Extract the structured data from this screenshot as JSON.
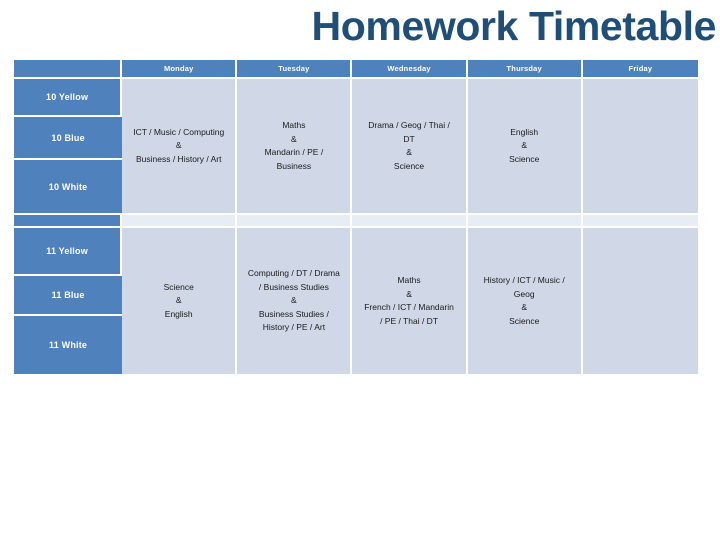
{
  "slide": {
    "title": "Homework Timetable",
    "title_color": "#1F4E79",
    "header_fill": "#4F81BD",
    "cell_fill": "#D0D8E8",
    "spacer_fill": "#E8ECF4"
  },
  "table": {
    "corner_label": "",
    "day_headers": [
      "Monday",
      "Tuesday",
      "Wednesday",
      "Thursday",
      "Friday"
    ],
    "blocks": [
      {
        "year": "10",
        "row_labels": [
          "10 Yellow",
          "10 Blue",
          "10 White"
        ],
        "cells": [
          {
            "day": "Monday",
            "lines": [
              "ICT / Music / Computing",
              "&",
              "Business / History / Art"
            ]
          },
          {
            "day": "Tuesday",
            "lines": [
              "Maths",
              "&",
              "Mandarin / PE /",
              "Business"
            ]
          },
          {
            "day": "Wednesday",
            "lines": [
              "Drama / Geog / Thai /",
              "DT",
              "&",
              "Science"
            ]
          },
          {
            "day": "Thursday",
            "lines": [
              "English",
              "&",
              "Science"
            ]
          },
          {
            "day": "Friday",
            "lines": []
          }
        ]
      },
      {
        "year": "11",
        "row_labels": [
          "11 Yellow",
          "11 Blue",
          "11 White"
        ],
        "cells": [
          {
            "day": "Monday",
            "lines": [
              "Science",
              "&",
              "English"
            ]
          },
          {
            "day": "Tuesday",
            "lines": [
              "Computing / DT / Drama",
              "/ Business Studies",
              "&",
              "Business Studies /",
              "History / PE / Art"
            ]
          },
          {
            "day": "Wednesday",
            "lines": [
              "Maths",
              "&",
              "French / ICT / Mandarin",
              "/ PE / Thai / DT"
            ]
          },
          {
            "day": "Thursday",
            "lines": [
              "History / ICT / Music /",
              "Geog",
              "&",
              "Science"
            ]
          },
          {
            "day": "Friday",
            "lines": []
          }
        ]
      }
    ]
  }
}
